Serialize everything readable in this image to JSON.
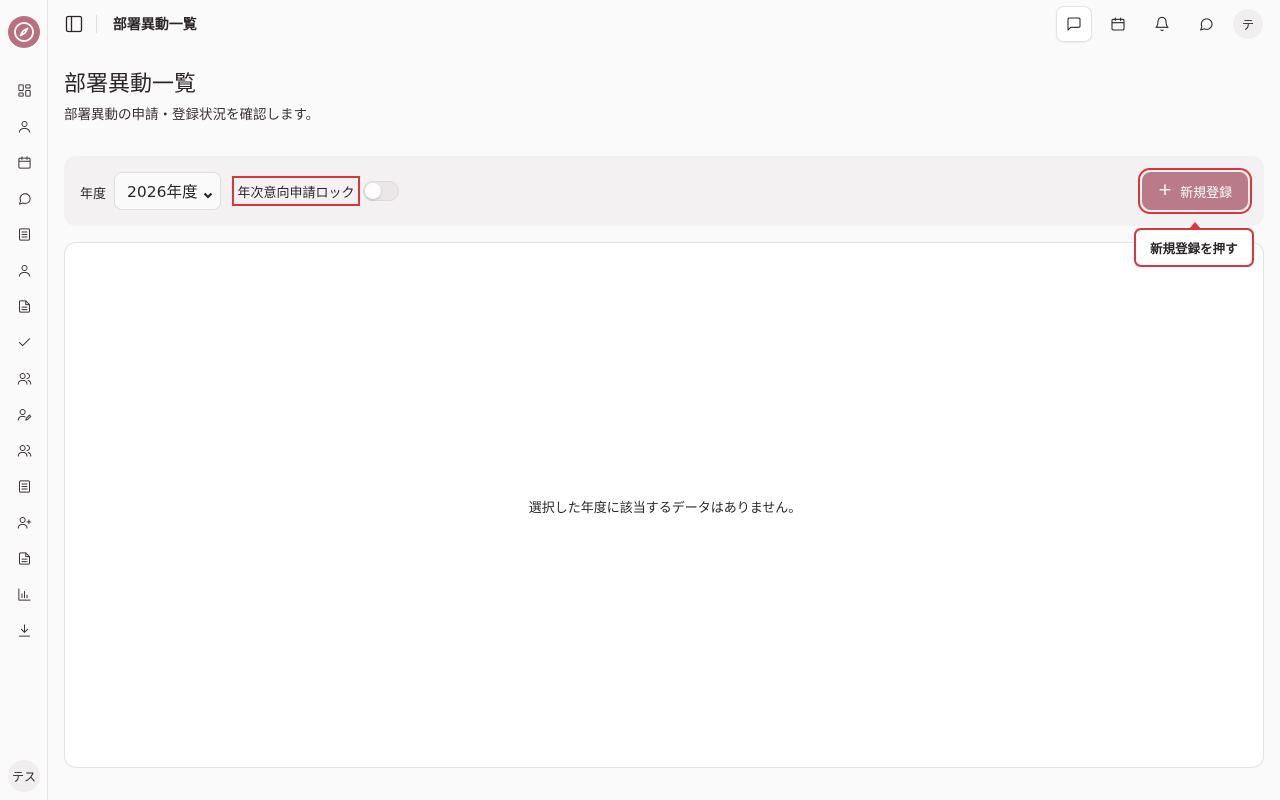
{
  "sidebar": {
    "items": [
      {
        "icon": "dashboard-icon"
      },
      {
        "icon": "user-icon"
      },
      {
        "icon": "calendar-icon"
      },
      {
        "icon": "message-circle-icon"
      },
      {
        "icon": "notebook-icon"
      },
      {
        "icon": "user-icon"
      },
      {
        "icon": "file-text-icon"
      },
      {
        "icon": "check-icon"
      },
      {
        "icon": "users-icon"
      },
      {
        "icon": "user-edit-icon"
      },
      {
        "icon": "users-icon"
      },
      {
        "icon": "notebook-icon"
      },
      {
        "icon": "user-plus-icon"
      },
      {
        "icon": "file-text-icon"
      },
      {
        "icon": "bar-chart-icon"
      },
      {
        "icon": "download-icon"
      }
    ],
    "user_initials": "テス"
  },
  "header": {
    "title": "部署異動一覧",
    "avatar": "テ"
  },
  "page": {
    "title": "部署異動一覧",
    "description": "部署異動の申請・登録状況を確認します。"
  },
  "toolbar": {
    "year_label": "年度",
    "year_selected": "2026年度",
    "lock_label": "年次意向申請ロック",
    "lock_enabled": false,
    "new_button": "新規登録",
    "new_button_icon": "plus-icon"
  },
  "tooltip": {
    "text": "新規登録を押す"
  },
  "content": {
    "empty_message": "選択した年度に該当するデータはありません。"
  },
  "colors": {
    "accent": "#b97a89",
    "highlight": "#d9363e",
    "logo": "#b8707f"
  }
}
